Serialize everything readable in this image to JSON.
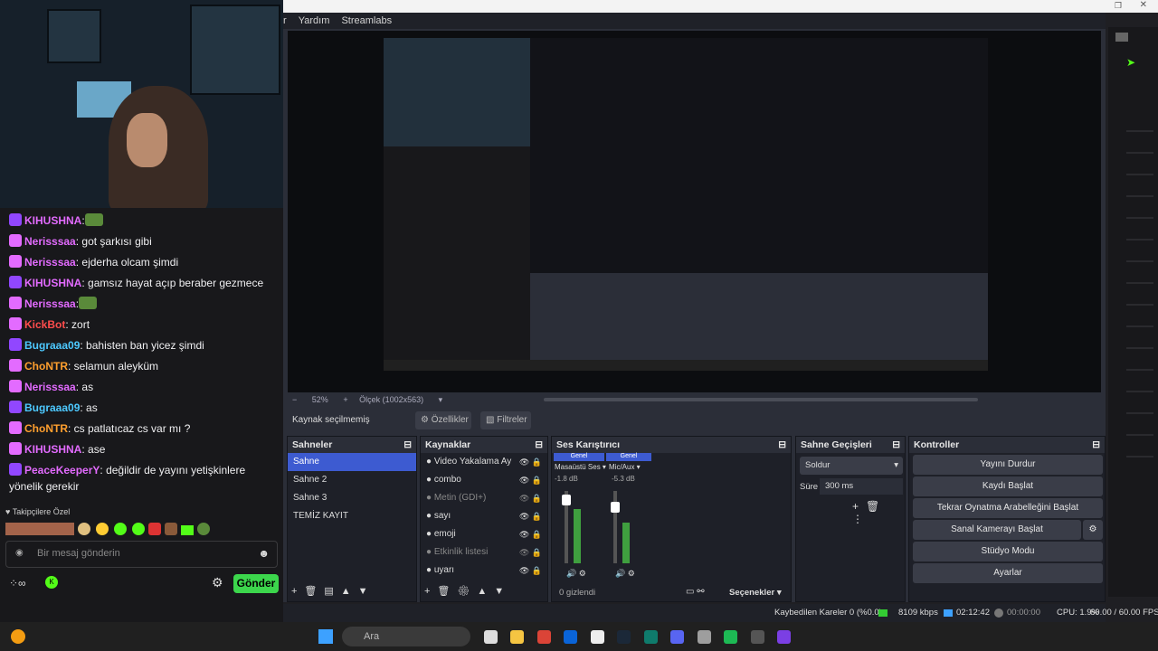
{
  "menubar": {
    "items": [
      "r",
      "Yardım",
      "Streamlabs"
    ]
  },
  "chat": {
    "messages": [
      {
        "user": "KIHUSHNA",
        "text": "",
        "color": "#e36bff",
        "emote": true
      },
      {
        "user": "Nerisssaa",
        "text": " got şarkısı gibi",
        "color": "#e36bff"
      },
      {
        "user": "Nerisssaa",
        "text": " ejderha olcam şimdi",
        "color": "#e36bff"
      },
      {
        "user": "KIHUSHNA",
        "text": " gamsız hayat açıp beraber gezmece",
        "color": "#e36bff"
      },
      {
        "user": "Nerisssaa",
        "text": "",
        "color": "#e36bff",
        "emote": true
      },
      {
        "user": "KickBot",
        "text": " zort",
        "color": "#ff4d4d"
      },
      {
        "user": "Bugraaa09",
        "text": " bahisten ban yicez şimdi",
        "color": "#4dc9ff"
      },
      {
        "user": "ChoNTR",
        "text": " selamun aleyküm",
        "color": "#ff9f2e"
      },
      {
        "user": "Nerisssaa",
        "text": " as",
        "color": "#e36bff"
      },
      {
        "user": "Bugraaa09",
        "text": " as",
        "color": "#4dc9ff"
      },
      {
        "user": "ChoNTR",
        "text": " cs patlatıcaz cs var mı ?",
        "color": "#ff9f2e"
      },
      {
        "user": "KIHUSHNA",
        "text": " ase",
        "color": "#e36bff"
      },
      {
        "user": "PeaceKeeperY",
        "text": " değildir de yayını yetişkinlere yönelik gerekir",
        "color": "#e36bff"
      }
    ],
    "followers_label": "Takipçilere Özel",
    "input_placeholder": "Bir mesaj gönderin",
    "send_label": "Gönder"
  },
  "obs": {
    "zoom": "52%",
    "scale": "Ölçek (1002x563)",
    "source_bar": {
      "selected": "Kaynak seçilmemiş",
      "properties": "Özellikler",
      "filters": "Filtreler"
    },
    "scenes": {
      "title": "Sahneler",
      "items": [
        "Sahne",
        "Sahne 2",
        "Sahne 3",
        "TEMİZ KAYIT"
      ]
    },
    "sources": {
      "title": "Kaynaklar",
      "items": [
        "Video Yakalama Ay",
        "combo",
        "Metin (GDI+)",
        "sayı",
        "emoji",
        "Etkinlik listesi",
        "uyarı"
      ]
    },
    "mixer": {
      "title": "Ses Karıştırıcı",
      "ch1": {
        "head": "Genel",
        "name": "Masaüstü Ses",
        "db": "-1.8 dB"
      },
      "ch2": {
        "head": "Genel",
        "name": "Mic/Aux",
        "db": "-5.3 dB"
      },
      "hidden": "0 gizlendi",
      "options": "Seçenekler"
    },
    "transitions": {
      "title": "Sahne Geçişleri",
      "type": "Soldur",
      "duration_label": "Süre",
      "duration": "300 ms"
    },
    "controls": {
      "title": "Kontroller",
      "buttons": [
        "Yayını Durdur",
        "Kaydı Başlat",
        "Tekrar Oynatma Arabelleğini Başlat",
        "Sanal Kamerayı Başlat",
        "Stüdyo Modu",
        "Ayarlar"
      ]
    },
    "status": {
      "dropped": "Kaybedilen Kareler 0 (%0.0)",
      "bitrate": "8109 kbps",
      "live": "02:12:42",
      "rec": "00:00:00",
      "cpu": "CPU: 1.9%",
      "fps": "60.00 / 60.00 FPS"
    }
  },
  "taskbar": {
    "search": "Ara"
  },
  "colors": {
    "accent": "#3d5bd1",
    "kick": "#53fc18",
    "live": "#3da1ff"
  }
}
